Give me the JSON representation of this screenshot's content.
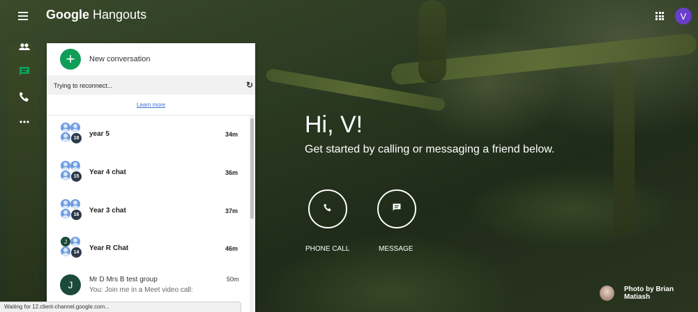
{
  "header": {
    "brand_google": "Google",
    "brand_product": "Hangouts",
    "user_initial": "V"
  },
  "nav": {
    "icons": [
      "people-icon",
      "chat-icon",
      "phone-icon",
      "more-icon"
    ],
    "active": "chat-icon"
  },
  "panel": {
    "new_conversation_label": "New conversation",
    "reconnect_text": "Trying to reconnect...",
    "learn_more": "Learn more",
    "conversations": [
      {
        "name": "year 5",
        "time": "34m",
        "count": "18"
      },
      {
        "name": "Year 4 chat",
        "time": "36m",
        "count": "15"
      },
      {
        "name": "Year 3 chat",
        "time": "37m",
        "count": "16"
      },
      {
        "name": "Year R Chat",
        "time": "46m",
        "count": "14",
        "first_initial": "J"
      }
    ],
    "last_conversation": {
      "initial": "J",
      "name": "Mr D Mrs B test group",
      "message": "You: Join me in a Meet video call:",
      "time": "50m"
    }
  },
  "status_bar": "Waiting for 12.client-channel.google.com...",
  "hero": {
    "greeting": "Hi, V!",
    "subtitle": "Get started by calling or messaging a friend below.",
    "phone_label": "PHONE CALL",
    "message_label": "MESSAGE"
  },
  "photo_credit": "Photo by Brian Matiash",
  "colors": {
    "accent_green": "#0f9d58",
    "avatar_purple": "#6a3ecb",
    "link_blue": "#3b6fd6"
  }
}
